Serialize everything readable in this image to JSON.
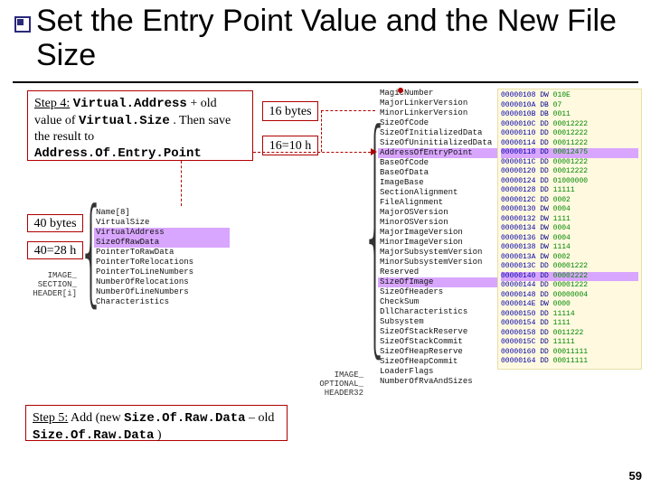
{
  "title": "Set the Entry Point Value and the New File Size",
  "page_number": "59",
  "step4": {
    "prefix": "Step 4:",
    "va": "Virtual.Address",
    "plus_old": " + old value of ",
    "vs": "Virtual.Size",
    "then": ". Then save the result to ",
    "aoep": "Address.Of.Entry.Point"
  },
  "step5": {
    "prefix": "Step 5:",
    "text": " Add (new ",
    "sord": "Size.Of.Raw.Data",
    "minus": " – old ",
    "sord2": "Size.Of.Raw.Data",
    "close": " )"
  },
  "mini": {
    "b16": "16 bytes",
    "h16": "16=10 h",
    "b40": "40 bytes",
    "h40": "40=28 h"
  },
  "sec_label_ish": "IMAGE_SECTION_HEADER[i]",
  "sec_label_opt": "IMAGE_OPTIONAL_HEADER32",
  "ish_fields": [
    {
      "t": "Name[8]",
      "hl": false
    },
    {
      "t": "VirtualSize",
      "hl": false
    },
    {
      "t": "VirtualAddress",
      "hl": true
    },
    {
      "t": "SizeOfRawData",
      "hl": true
    },
    {
      "t": "PointerToRawData",
      "hl": false
    },
    {
      "t": "PointerToRelocations",
      "hl": false
    },
    {
      "t": "PointerToLineNumbers",
      "hl": false
    },
    {
      "t": "NumberOfRelocations",
      "hl": false
    },
    {
      "t": "NumberOfLineNumbers",
      "hl": false
    },
    {
      "t": "Characteristics",
      "hl": false
    }
  ],
  "opt_fields": [
    {
      "t": "MagicNumber",
      "hl": false
    },
    {
      "t": "MajorLinkerVersion",
      "hl": false
    },
    {
      "t": "MinorLinkerVersion",
      "hl": false
    },
    {
      "t": "SizeOfCode",
      "hl": false
    },
    {
      "t": "SizeOfInitializedData",
      "hl": false
    },
    {
      "t": "SizeOfUninitializedData",
      "hl": false
    },
    {
      "t": "AddressOfEntryPoint",
      "hl": true
    },
    {
      "t": "BaseOfCode",
      "hl": false
    },
    {
      "t": "BaseOfData",
      "hl": false
    },
    {
      "t": "ImageBase",
      "hl": false
    },
    {
      "t": "SectionAlignment",
      "hl": false
    },
    {
      "t": "FileAlignment",
      "hl": false
    },
    {
      "t": "MajorOSVersion",
      "hl": false
    },
    {
      "t": "MinorOSVersion",
      "hl": false
    },
    {
      "t": "MajorImageVersion",
      "hl": false
    },
    {
      "t": "MinorImageVersion",
      "hl": false
    },
    {
      "t": "MajorSubsystemVersion",
      "hl": false
    },
    {
      "t": "MinorSubsystemVersion",
      "hl": false
    },
    {
      "t": "Reserved",
      "hl": false
    },
    {
      "t": "SizeOfImage",
      "hl": true
    },
    {
      "t": "SizeOfHeaders",
      "hl": false
    },
    {
      "t": "CheckSum",
      "hl": false
    },
    {
      "t": "DllCharacteristics",
      "hl": false
    },
    {
      "t": "Subsystem",
      "hl": false
    },
    {
      "t": "SizeOfStackReserve",
      "hl": false
    },
    {
      "t": "SizeOfStackCommit",
      "hl": false
    },
    {
      "t": "SizeOfHeapReserve",
      "hl": false
    },
    {
      "t": "SizeOfHeapCommit",
      "hl": false
    },
    {
      "t": "LoaderFlags",
      "hl": false
    },
    {
      "t": "NumberOfRvaAndSizes",
      "hl": false
    }
  ],
  "hex_rows": [
    {
      "a": "00000108",
      "o": "DW",
      "v": "010E",
      "hl": false
    },
    {
      "a": "0000010A",
      "o": "DB",
      "v": "07",
      "hl": false
    },
    {
      "a": "0000010B",
      "o": "DB",
      "v": "0011",
      "hl": false
    },
    {
      "a": "0000010C",
      "o": "DD",
      "v": "00012222",
      "hl": false
    },
    {
      "a": "00000110",
      "o": "DD",
      "v": "00012222",
      "hl": false
    },
    {
      "a": "00000114",
      "o": "DD",
      "v": "00011222",
      "hl": false
    },
    {
      "a": "00000118",
      "o": "DD",
      "v": "00012475",
      "hl": true
    },
    {
      "a": "0000011C",
      "o": "DD",
      "v": "00001222",
      "hl": false
    },
    {
      "a": "00000120",
      "o": "DD",
      "v": "00012222",
      "hl": false
    },
    {
      "a": "00000124",
      "o": "DD",
      "v": "01000000",
      "hl": false
    },
    {
      "a": "00000128",
      "o": "DD",
      "v": "11111",
      "hl": false
    },
    {
      "a": "0000012C",
      "o": "DD",
      "v": "0002",
      "hl": false
    },
    {
      "a": "00000130",
      "o": "DW",
      "v": "0004",
      "hl": false
    },
    {
      "a": "00000132",
      "o": "DW",
      "v": "1111",
      "hl": false
    },
    {
      "a": "00000134",
      "o": "DW",
      "v": "0004",
      "hl": false
    },
    {
      "a": "00000136",
      "o": "DW",
      "v": "0004",
      "hl": false
    },
    {
      "a": "00000138",
      "o": "DW",
      "v": "1114",
      "hl": false
    },
    {
      "a": "0000013A",
      "o": "DW",
      "v": "0002",
      "hl": false
    },
    {
      "a": "0000013C",
      "o": "DD",
      "v": "00001222",
      "hl": false
    },
    {
      "a": "00000140",
      "o": "DD",
      "v": "00002222",
      "hl": true
    },
    {
      "a": "00000144",
      "o": "DD",
      "v": "00001222",
      "hl": false
    },
    {
      "a": "00000148",
      "o": "DD",
      "v": "00000004",
      "hl": false
    },
    {
      "a": "0000014E",
      "o": "DW",
      "v": "0000",
      "hl": false
    },
    {
      "a": "00000150",
      "o": "DD",
      "v": "11114",
      "hl": false
    },
    {
      "a": "00000154",
      "o": "DD",
      "v": "1111",
      "hl": false
    },
    {
      "a": "00000158",
      "o": "DD",
      "v": "0011222",
      "hl": false
    },
    {
      "a": "0000015C",
      "o": "DD",
      "v": "11111",
      "hl": false
    },
    {
      "a": "00000160",
      "o": "DD",
      "v": "00011111",
      "hl": false
    },
    {
      "a": "00000164",
      "o": "DD",
      "v": "00011111",
      "hl": false
    }
  ]
}
